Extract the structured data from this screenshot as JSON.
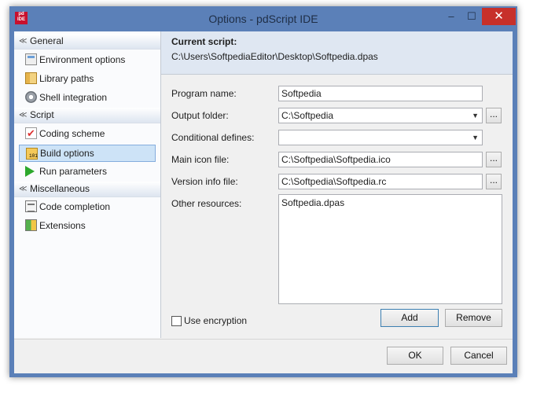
{
  "window": {
    "title": "Options - pdScript IDE",
    "app_icon_text_1": "pd",
    "app_icon_text_2": "IDE"
  },
  "titlebar_buttons": {
    "minimize": "–",
    "maximize": "☐",
    "close": "✕"
  },
  "sidebar": {
    "groups": [
      {
        "label": "General",
        "items": [
          {
            "label": "Environment options",
            "icon": "environment-icon"
          },
          {
            "label": "Library paths",
            "icon": "library-icon"
          },
          {
            "label": "Shell integration",
            "icon": "shell-icon"
          }
        ]
      },
      {
        "label": "Script",
        "items": [
          {
            "label": "Coding scheme",
            "icon": "coding-icon"
          },
          {
            "label": "Build options",
            "icon": "build-icon",
            "selected": true
          },
          {
            "label": "Run parameters",
            "icon": "run-icon"
          }
        ]
      },
      {
        "label": "Miscellaneous",
        "items": [
          {
            "label": "Code completion",
            "icon": "code-completion-icon"
          },
          {
            "label": "Extensions",
            "icon": "extensions-icon"
          }
        ]
      }
    ],
    "chevron": "≪"
  },
  "header": {
    "label": "Current script:",
    "path": "C:\\Users\\SoftpediaEditor\\Desktop\\Softpedia.dpas"
  },
  "form": {
    "program_name": {
      "label": "Program name:",
      "value": "Softpedia"
    },
    "output_folder": {
      "label": "Output folder:",
      "value": "C:\\Softpedia"
    },
    "conditional_defines": {
      "label": "Conditional defines:",
      "value": ""
    },
    "main_icon": {
      "label": "Main icon file:",
      "value": "C:\\Softpedia\\Softpedia.ico"
    },
    "version_info": {
      "label": "Version info file:",
      "value": "C:\\Softpedia\\Softpedia.rc"
    },
    "other_resources": {
      "label": "Other resources:",
      "items": [
        "Softpedia.dpas"
      ]
    },
    "browse_label": "...",
    "dropdown_arrow": "▼"
  },
  "use_encryption": {
    "label": "Use encryption",
    "checked": false
  },
  "buttons": {
    "add": "Add",
    "remove": "Remove",
    "ok": "OK",
    "cancel": "Cancel"
  }
}
